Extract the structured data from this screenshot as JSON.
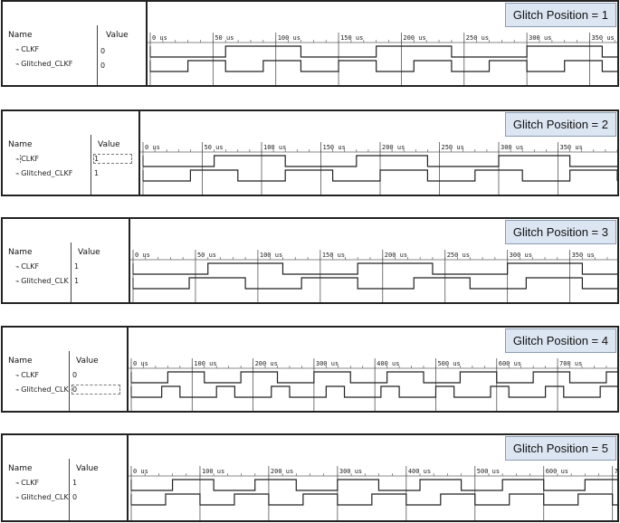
{
  "columns": {
    "name": "Name",
    "value": "Value"
  },
  "panels": [
    {
      "label": "Glitch Position = 1",
      "xlim": [
        0,
        372
      ],
      "major": 50,
      "minor": 10,
      "tick_labels": [
        "0 us",
        "50 us",
        "100 us",
        "150 us",
        "200 us",
        "250 us",
        "300 us",
        "350 us"
      ],
      "signals": [
        {
          "name": "CLKF",
          "value": "0",
          "init": 0,
          "transitions": [
            60,
            120,
            180,
            240,
            300,
            360
          ]
        },
        {
          "name": "Glitched_CLKF",
          "value": "0",
          "init": 0,
          "transitions": [
            30,
            60,
            90,
            120,
            150,
            180,
            210,
            240,
            270,
            300,
            330,
            360
          ]
        }
      ]
    },
    {
      "label": "Glitch Position = 2",
      "xlim": [
        0,
        400
      ],
      "major": 50,
      "minor": 10,
      "tick_labels": [
        "0 us",
        "50 us",
        "100 us",
        "150 us",
        "200 us",
        "250 us",
        "300 us",
        "350 us"
      ],
      "signals": [
        {
          "name": "CLKF",
          "value": "1",
          "init": 0,
          "transitions": [
            60,
            120,
            180,
            240,
            300,
            360
          ]
        },
        {
          "name": "Glitched_CLKF",
          "value": "1",
          "init": 0,
          "transitions": [
            40,
            80,
            120,
            160,
            200,
            240,
            280,
            320,
            360,
            400
          ]
        }
      ]
    },
    {
      "label": "Glitch Position = 3",
      "xlim": [
        0,
        388
      ],
      "major": 50,
      "minor": 10,
      "tick_labels": [
        "0 us",
        "50 us",
        "100 us",
        "150 us",
        "200 us",
        "250 us",
        "300 us",
        "350 us"
      ],
      "signals": [
        {
          "name": "CLKF",
          "value": "1",
          "init": 0,
          "transitions": [
            60,
            120,
            180,
            240,
            300,
            360
          ]
        },
        {
          "name": "Glitched_CLK",
          "value": "1",
          "init": 0,
          "transitions": [
            45,
            90,
            135,
            180,
            225,
            270,
            315,
            360
          ]
        }
      ]
    },
    {
      "label": "Glitch Position = 4",
      "xlim": [
        0,
        798
      ],
      "major": 100,
      "minor": 20,
      "tick_labels": [
        "0 us",
        "100 us",
        "200 us",
        "300 us",
        "400 us",
        "500 us",
        "600 us",
        "700 us"
      ],
      "signals": [
        {
          "name": "CLKF",
          "value": "0",
          "init": 0,
          "transitions": [
            60,
            120,
            180,
            240,
            300,
            360,
            420,
            480,
            540,
            600,
            660,
            720,
            780
          ]
        },
        {
          "name": "Glitched_CLK",
          "value": "0",
          "init": 0,
          "transitions": [
            50,
            80,
            140,
            170,
            230,
            260,
            320,
            350,
            410,
            440,
            500,
            530,
            590,
            620,
            680,
            710,
            770
          ]
        }
      ]
    },
    {
      "label": "Glitch Position = 5",
      "xlim": [
        0,
        707
      ],
      "major": 100,
      "minor": 20,
      "tick_labels": [
        "0 us",
        "100 us",
        "200 us",
        "300 us",
        "400 us",
        "500 us",
        "600 us",
        "7"
      ],
      "signals": [
        {
          "name": "CLKF",
          "value": "1",
          "init": 0,
          "transitions": [
            60,
            120,
            180,
            240,
            300,
            360,
            420,
            480,
            540,
            600,
            660
          ]
        },
        {
          "name": "Glitched_CLK",
          "value": "0",
          "init": 0,
          "transitions": [
            50,
            100,
            150,
            200,
            250,
            300,
            350,
            400,
            450,
            500,
            550,
            600,
            650,
            700
          ]
        }
      ]
    }
  ]
}
